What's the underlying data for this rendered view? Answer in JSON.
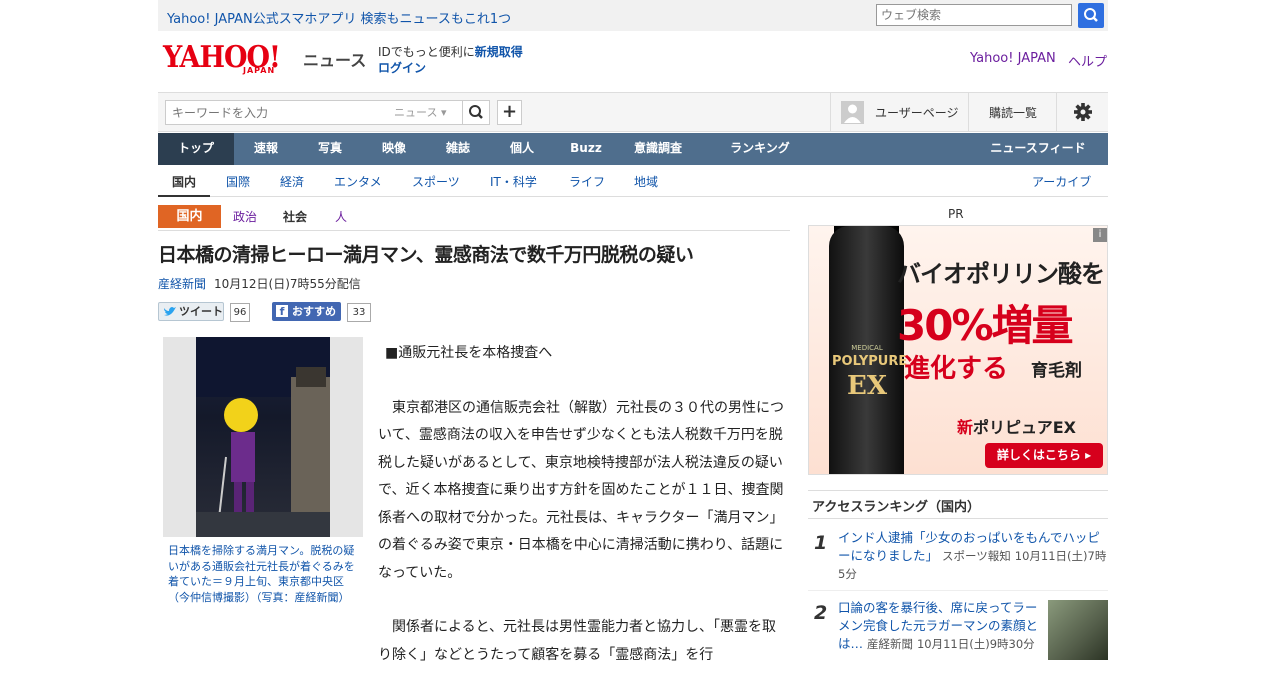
{
  "promo": {
    "text": "Yahoo! JAPAN公式スマホアプリ 検索もニュースもこれ1つ",
    "search_placeholder": "ウェブ検索"
  },
  "header": {
    "logo": "YAHOO!",
    "logo_sub": "JAPAN",
    "section": "ニュース",
    "id_line": "IDでもっと便利に",
    "register": "新規取得",
    "login": "ログイン",
    "yahoo_japan": "Yahoo! JAPAN",
    "help": "ヘルプ"
  },
  "toolbar": {
    "keyword_placeholder": "キーワードを入力",
    "scope": "ニュース ▾",
    "plus": "+",
    "user_page": "ユーザーページ",
    "subscribe": "購読一覧"
  },
  "nav": [
    "トップ",
    "速報",
    "写真",
    "映像",
    "雑誌",
    "個人",
    "Buzz",
    "意識調査",
    "ランキング",
    "ニュースフィード"
  ],
  "subnav": [
    "国内",
    "国際",
    "経済",
    "エンタメ",
    "スポーツ",
    "IT・科学",
    "ライフ",
    "地域",
    "アーカイブ"
  ],
  "category": {
    "badge": "国内",
    "items": [
      "政治",
      "社会",
      "人"
    ]
  },
  "article": {
    "headline": "日本橋の清掃ヒーロー満月マン、霊感商法で数千万円脱税の疑い",
    "source": "産経新聞",
    "date": "10月12日(日)7時55分配信",
    "tweet_label": "ツイート",
    "tweet_count": "96",
    "fb_label": "おすすめ",
    "fb_count": "33",
    "caption": "日本橋を掃除する満月マン。脱税の疑いがある通販会社元社長が着ぐるみを着ていた＝９月上旬、東京都中央区（今仲信博撮影）（写真：産経新聞）",
    "paragraphs": [
      "■通販元社長を本格捜査へ",
      "東京都港区の通信販売会社（解散）元社長の３０代の男性について、霊感商法の収入を申告せず少なくとも法人税数千万円を脱税した疑いがあるとして、東京地検特捜部が法人税法違反の疑いで、近く本格捜査に乗り出す方針を固めたことが１１日、捜査関係者への取材で分かった。元社長は、キャラクター「満月マン」の着ぐるみ姿で東京・日本橋を中心に清掃活動に携わり、話題になっていた。",
      "関係者によると、元社長は男性霊能力者と協力し、「悪霊を取り除く」などとうたって顧客を募る「霊感商法」を行"
    ]
  },
  "ad": {
    "pr": "PR",
    "line1": "バイオポリリン酸を",
    "line2": "30%増量",
    "line3": "進化する",
    "line3b": "育毛剤",
    "line4_red": "新",
    "line4": "ポリピュアEX",
    "cta": "詳しくはこちら ▸",
    "bottle_l1": "MEDICAL",
    "bottle_l2": "POLYPURE",
    "bottle_l3": "EX",
    "info": "i"
  },
  "ranking": {
    "title": "アクセスランキング（国内）",
    "items": [
      {
        "num": "1",
        "title": "インド人逮捕「少女のおっぱいをもんでハッピーになりました」",
        "source": "スポーツ報知",
        "date": "10月11日(土)7時5分"
      },
      {
        "num": "2",
        "title": "口論の客を暴行後、席に戻ってラーメン完食した元ラガーマンの素顔とは…",
        "source": "産経新聞",
        "date": "10月11日(土)9時30分"
      }
    ]
  },
  "colors": {
    "brand_red": "#e60012",
    "nav": "#4f6e8d",
    "nav_active": "#2c3e50",
    "category": "#e06524",
    "link": "#1155aa"
  }
}
